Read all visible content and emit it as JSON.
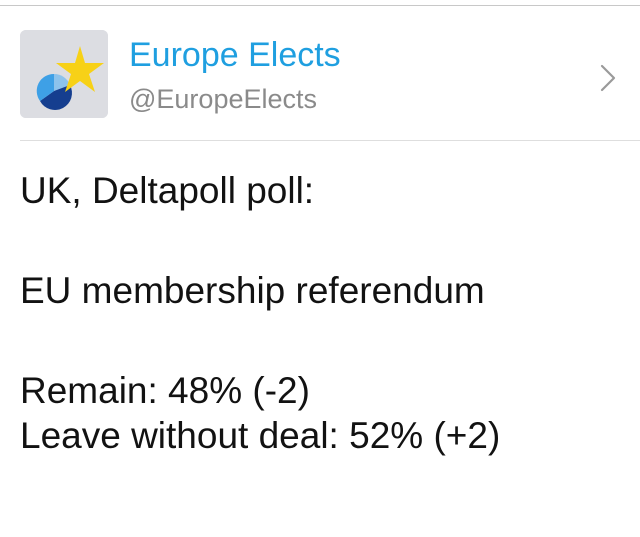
{
  "author": {
    "display_name": "Europe Elects",
    "handle": "@EuropeElects",
    "avatar_icon": "europe-elects-logo-icon",
    "open_icon": "chevron-right-icon"
  },
  "tweet": {
    "line1": "UK, Deltapoll poll:",
    "line2": "EU membership referendum",
    "line3": "Remain: 48% (-2)",
    "line4": "Leave without deal: 52% (+2)"
  },
  "colors": {
    "name": "#1f9fe0",
    "handle": "#8a8a8a",
    "text": "#121212",
    "logo_star": "#f7d117",
    "logo_dark_blue": "#153e8f",
    "logo_light_blue": "#3ea0e6"
  }
}
